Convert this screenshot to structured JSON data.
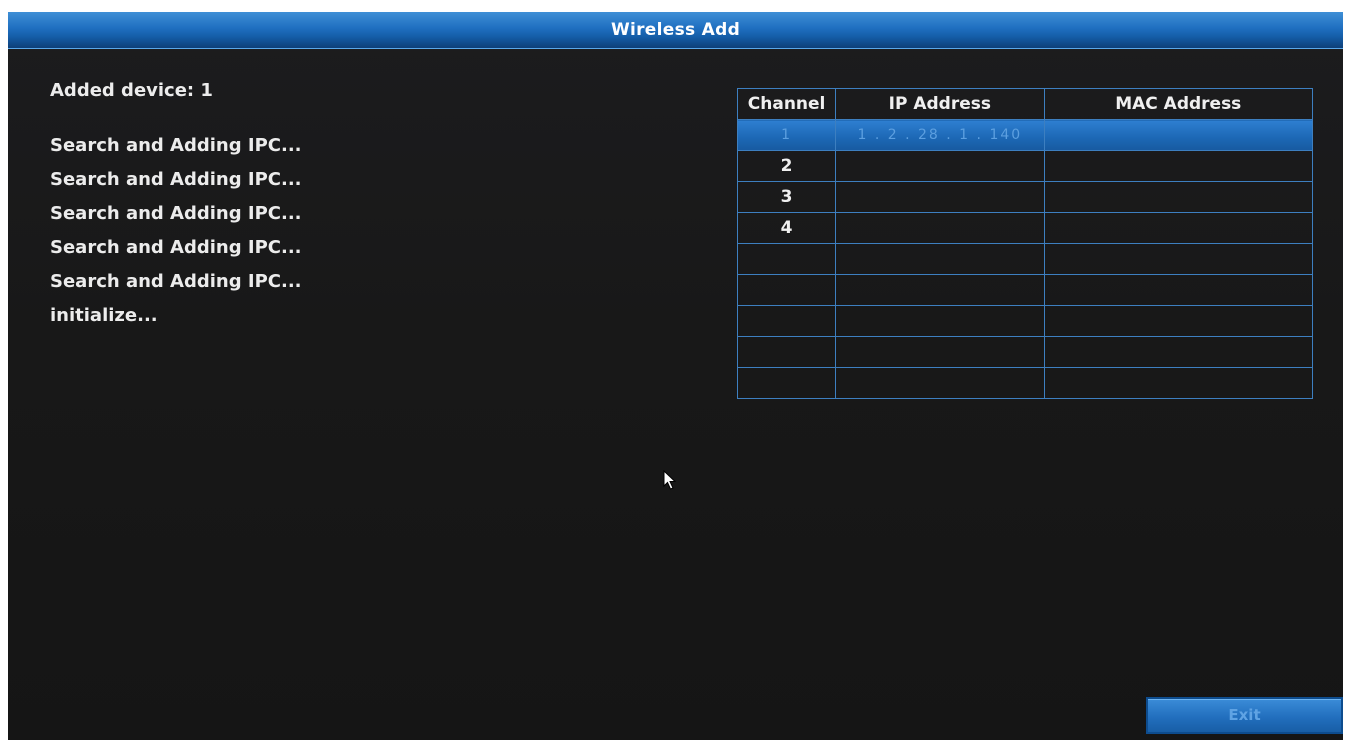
{
  "window": {
    "title": "Wireless Add"
  },
  "status": {
    "added_device": "Added device: 1",
    "log": [
      "Search and Adding IPC...",
      "Search and Adding IPC...",
      "Search and Adding IPC...",
      "Search and Adding IPC...",
      "Search and Adding IPC...",
      "initialize..."
    ]
  },
  "table": {
    "headers": [
      "Channel",
      "IP Address",
      "MAC Address"
    ],
    "rows": [
      {
        "channel": "1",
        "ip": "1 . 2 . 28 . 1 . 140",
        "mac": "",
        "selected": true
      },
      {
        "channel": "2",
        "ip": "",
        "mac": "",
        "selected": false
      },
      {
        "channel": "3",
        "ip": "",
        "mac": "",
        "selected": false
      },
      {
        "channel": "4",
        "ip": "",
        "mac": "",
        "selected": false
      },
      {
        "channel": "",
        "ip": "",
        "mac": "",
        "selected": false
      },
      {
        "channel": "",
        "ip": "",
        "mac": "",
        "selected": false
      },
      {
        "channel": "",
        "ip": "",
        "mac": "",
        "selected": false
      },
      {
        "channel": "",
        "ip": "",
        "mac": "",
        "selected": false
      },
      {
        "channel": "",
        "ip": "",
        "mac": "",
        "selected": false
      }
    ]
  },
  "buttons": {
    "exit_label": "Exit"
  },
  "icons": {
    "cursor": "mouse-pointer-icon"
  },
  "colors": {
    "accent": "#1f6fc0",
    "grid": "#3d7fc0",
    "background": "#181818"
  }
}
